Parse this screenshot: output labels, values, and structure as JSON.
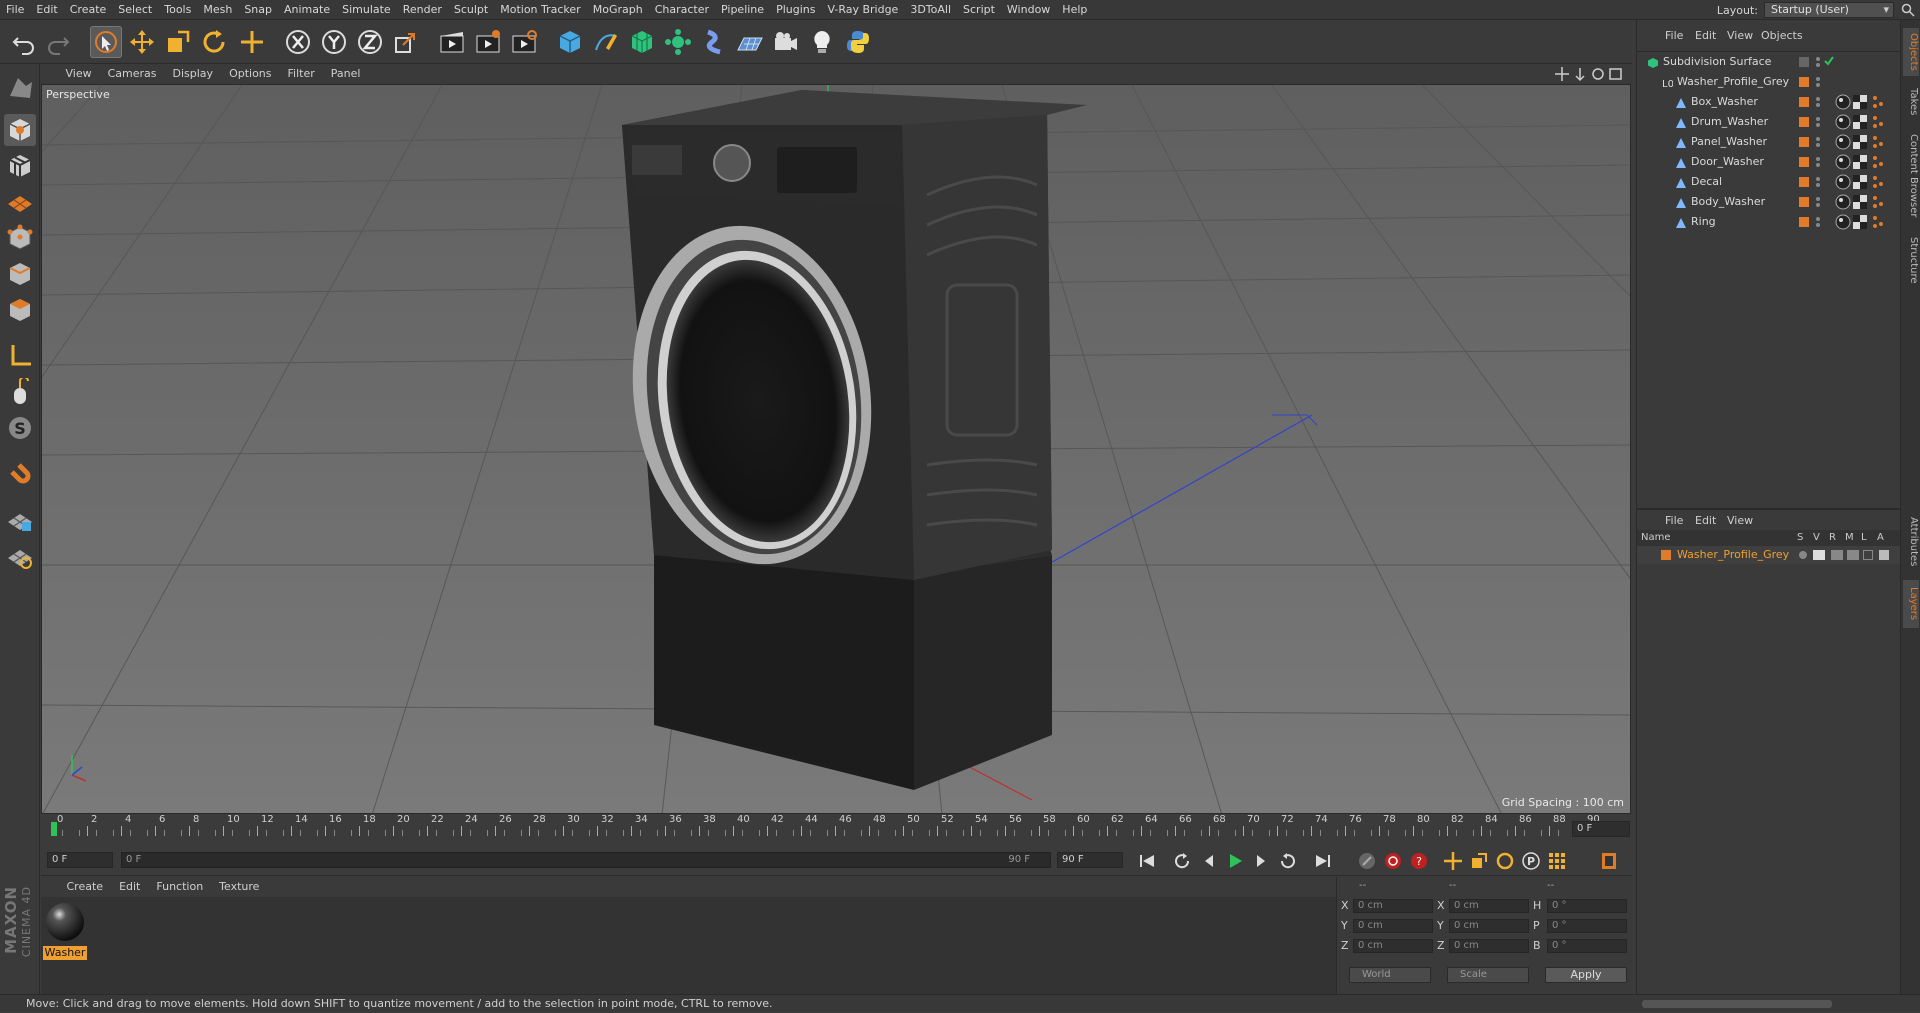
{
  "menubar": {
    "items": [
      "File",
      "Edit",
      "Create",
      "Select",
      "Tools",
      "Mesh",
      "Snap",
      "Animate",
      "Simulate",
      "Render",
      "Sculpt",
      "Motion Tracker",
      "MoGraph",
      "Character",
      "Pipeline",
      "Plugins",
      "V-Ray Bridge",
      "3DToAll",
      "Script",
      "Window",
      "Help"
    ],
    "layout_label": "Layout:",
    "layout_value": "Startup (User)"
  },
  "viewport": {
    "menu": [
      "View",
      "Cameras",
      "Display",
      "Options",
      "Filter",
      "Panel"
    ],
    "label": "Perspective",
    "grid_spacing": "Grid Spacing : 100 cm"
  },
  "timeline": {
    "ticks": [
      "0",
      "2",
      "4",
      "6",
      "8",
      "10",
      "12",
      "14",
      "16",
      "18",
      "20",
      "22",
      "24",
      "26",
      "28",
      "30",
      "32",
      "34",
      "36",
      "38",
      "40",
      "42",
      "44",
      "46",
      "48",
      "50",
      "52",
      "54",
      "56",
      "58",
      "60",
      "62",
      "64",
      "66",
      "68",
      "70",
      "72",
      "74",
      "76",
      "78",
      "80",
      "82",
      "84",
      "86",
      "88",
      "90"
    ],
    "current_frame_right": "0 F",
    "start_field": "0 F",
    "range_start": "0 F",
    "range_end": "90 F",
    "end_field": "90 F"
  },
  "material_panel": {
    "menu": [
      "Create",
      "Edit",
      "Function",
      "Texture"
    ],
    "material_name": "Washer"
  },
  "coordinates": {
    "header": [
      "--",
      "--",
      "--"
    ],
    "rows": [
      {
        "l1": "X",
        "v1": "0 cm",
        "l2": "X",
        "v2": "0 cm",
        "l3": "H",
        "v3": "0 °"
      },
      {
        "l1": "Y",
        "v1": "0 cm",
        "l2": "Y",
        "v2": "0 cm",
        "l3": "P",
        "v3": "0 °"
      },
      {
        "l1": "Z",
        "v1": "0 cm",
        "l2": "Z",
        "v2": "0 cm",
        "l3": "B",
        "v3": "0 °"
      }
    ],
    "world": "World",
    "scale": "Scale",
    "apply": "Apply"
  },
  "object_manager": {
    "menu": [
      "File",
      "Edit",
      "View",
      "Objects"
    ],
    "objects": [
      {
        "name": "Subdivision Surface",
        "depth": 0
      },
      {
        "name": "Washer_Profile_Grey",
        "depth": 1
      },
      {
        "name": "Box_Washer",
        "depth": 2
      },
      {
        "name": "Drum_Washer",
        "depth": 2
      },
      {
        "name": "Panel_Washer",
        "depth": 2
      },
      {
        "name": "Door_Washer",
        "depth": 2
      },
      {
        "name": "Decal",
        "depth": 2
      },
      {
        "name": "Body_Washer",
        "depth": 2
      },
      {
        "name": "Ring",
        "depth": 2
      }
    ]
  },
  "layer_manager": {
    "menu": [
      "File",
      "Edit",
      "View"
    ],
    "header_name": "Name",
    "header_cols": [
      "S",
      "V",
      "R",
      "M",
      "L",
      "A"
    ],
    "layer_name": "Washer_Profile_Grey"
  },
  "side_tabs": [
    "Objects",
    "Takes",
    "Content Browser",
    "Structure",
    "Attributes",
    "Layers"
  ],
  "status": "Move: Click and drag to move elements. Hold down SHIFT to quantize movement / add to the selection in point mode, CTRL to remove.",
  "brand": {
    "top": "MAXON",
    "bottom": "CINEMA 4D"
  },
  "colors": {
    "accent": "#e07b2a",
    "timeline_marker": "#2fc25b",
    "selected_layer": "#f0a030"
  }
}
